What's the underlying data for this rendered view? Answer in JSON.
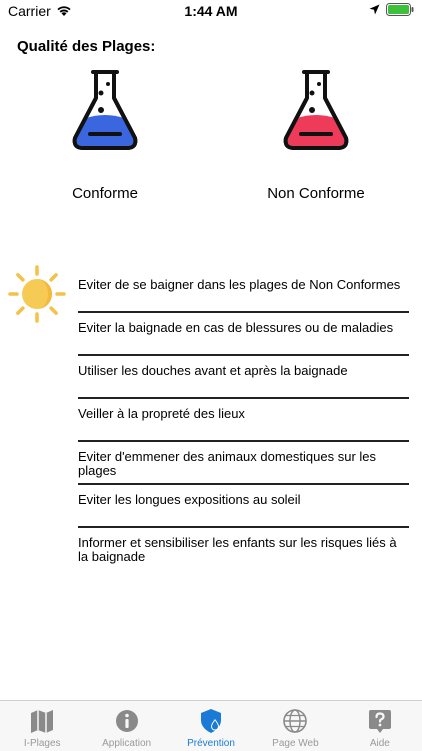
{
  "status_bar": {
    "carrier": "Carrier",
    "time": "1:44 AM"
  },
  "header": {
    "title": "Qualité des Plages:"
  },
  "quality": {
    "conforme": {
      "label": "Conforme",
      "color": "#3a66e0"
    },
    "non_conforme": {
      "label": "Non Conforme",
      "color": "#ee3b5a"
    }
  },
  "advice": {
    "icon": "sun-icon",
    "items": [
      "Eviter de se baigner dans les plages de Non Conformes",
      "Eviter la baignade en cas de blessures ou de maladies",
      "Utiliser les douches avant et après la baignade",
      "Veiller à la propreté des lieux",
      "Eviter d'emmener des animaux domestiques sur les plages",
      "Eviter les longues expositions au soleil",
      "Informer et sensibiliser les enfants sur les risques liés à la baignade"
    ]
  },
  "tab_bar": {
    "active_color": "#1a7ad6",
    "tabs": [
      {
        "label": "I-Plages",
        "icon": "map-icon"
      },
      {
        "label": "Application",
        "icon": "info-icon"
      },
      {
        "label": "Prévention",
        "icon": "shield-icon"
      },
      {
        "label": "Page Web",
        "icon": "globe-icon"
      },
      {
        "label": "Aide",
        "icon": "help-icon"
      }
    ]
  }
}
